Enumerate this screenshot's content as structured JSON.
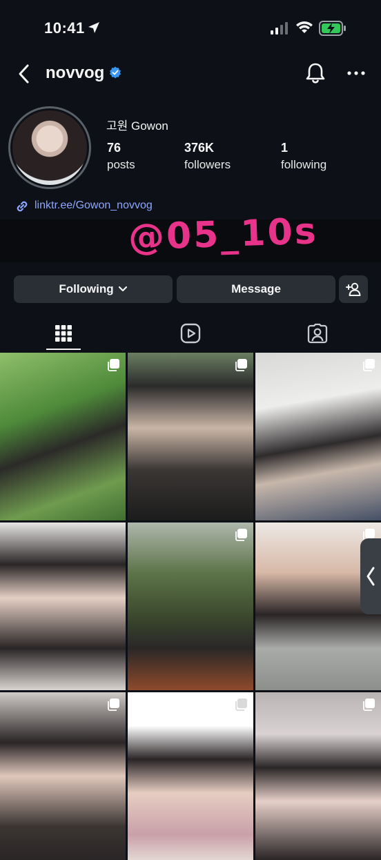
{
  "status_bar": {
    "time": "10:41",
    "icons": [
      "location-arrow-icon",
      "cellular-signal-icon",
      "wifi-icon",
      "battery-charging-icon"
    ]
  },
  "header": {
    "username": "novvog",
    "verified": true,
    "icons": [
      "back-chevron-icon",
      "bell-icon",
      "more-dots-icon"
    ]
  },
  "profile": {
    "display_name": "고원 Gowon",
    "stats": [
      {
        "value": "76",
        "label": "posts"
      },
      {
        "value": "376K",
        "label": "followers"
      },
      {
        "value": "1",
        "label": "following"
      }
    ],
    "link": "linktr.ee/Gowon_novvog",
    "watermark": "@05_10s"
  },
  "actions": {
    "following_label": "Following",
    "message_label": "Message",
    "add_person_icon": "add-person-icon"
  },
  "tabs": [
    {
      "name": "posts-grid",
      "icon": "grid-icon",
      "active": true
    },
    {
      "name": "reels",
      "icon": "reels-icon",
      "active": false
    },
    {
      "name": "tagged",
      "icon": "tagged-person-icon",
      "active": false
    }
  ],
  "grid": {
    "posts": [
      {
        "multi": true
      },
      {
        "multi": true
      },
      {
        "multi": true
      },
      {
        "multi": false
      },
      {
        "multi": true
      },
      {
        "multi": true
      },
      {
        "multi": true
      },
      {
        "multi": true
      },
      {
        "multi": true
      }
    ]
  },
  "colors": {
    "background": "#0d1117",
    "button": "#2a2f36",
    "link": "#8ea6ff",
    "verified": "#3897f0",
    "watermark": "#e8338a",
    "battery_fill": "#34c759"
  }
}
